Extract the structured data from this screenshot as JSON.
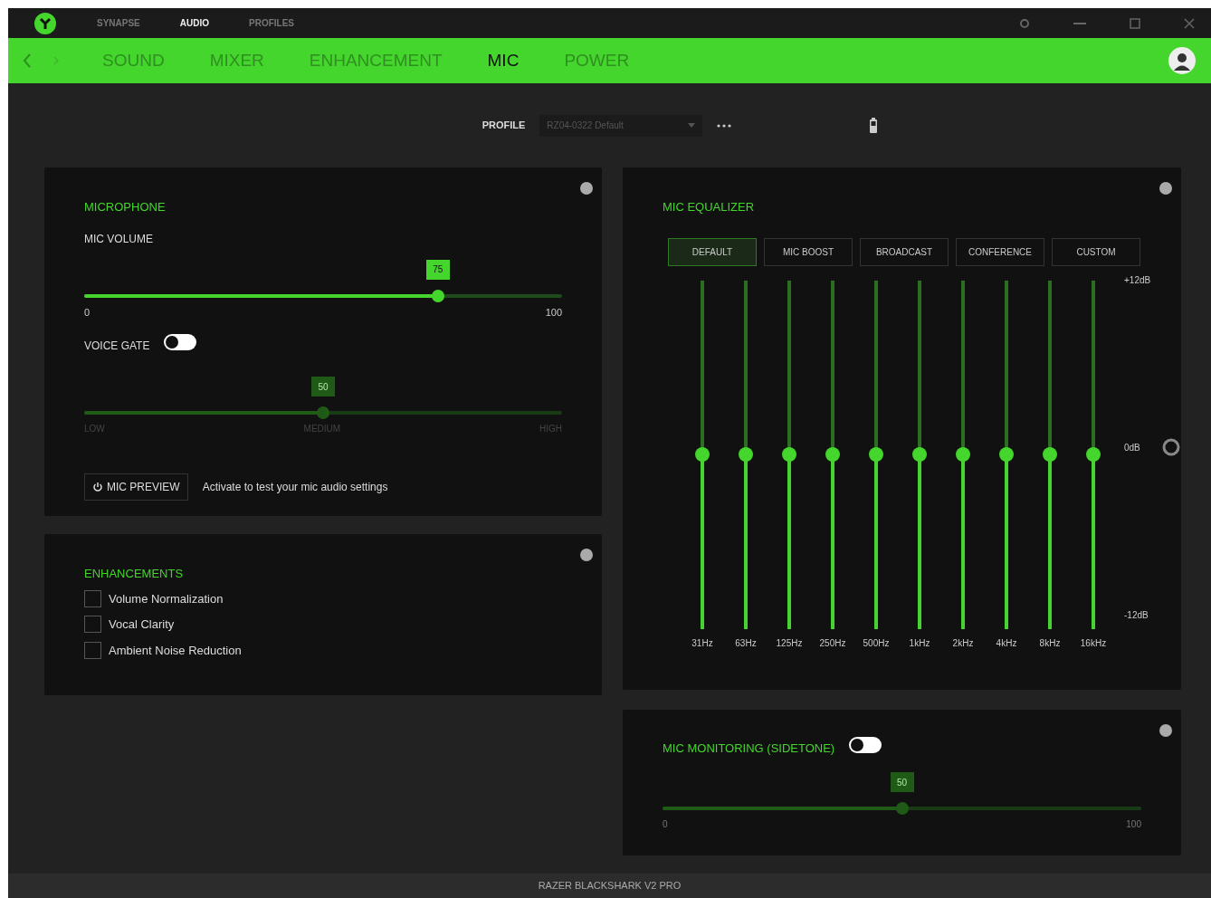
{
  "app_tabs": [
    {
      "label": "SYNAPSE",
      "selected": false
    },
    {
      "label": "AUDIO",
      "selected": true
    },
    {
      "label": "PROFILES",
      "selected": false
    }
  ],
  "section_tabs": [
    {
      "label": "SOUND",
      "selected": false
    },
    {
      "label": "MIXER",
      "selected": false
    },
    {
      "label": "ENHANCEMENT",
      "selected": false
    },
    {
      "label": "MIC",
      "selected": true
    },
    {
      "label": "POWER",
      "selected": false
    }
  ],
  "profile": {
    "label": "PROFILE",
    "value": "RZ04-0322 Default"
  },
  "microphone": {
    "title": "MICROPHONE",
    "volume": {
      "label": "MIC VOLUME",
      "value": "75",
      "level": 0.74,
      "min": "0",
      "max": "100"
    },
    "voice_gate": {
      "label": "VOICE GATE",
      "on": false,
      "value": "50",
      "level": 0.5,
      "ticks": [
        "LOW",
        "MEDIUM",
        "HIGH"
      ]
    },
    "preview": {
      "button": "MIC PREVIEW",
      "hint": "Activate to test your mic audio settings"
    }
  },
  "enhancements": {
    "title": "ENHANCEMENTS",
    "items": [
      {
        "label": "Volume Normalization",
        "checked": false
      },
      {
        "label": "Vocal Clarity",
        "checked": false
      },
      {
        "label": "Ambient Noise Reduction",
        "checked": false
      }
    ]
  },
  "equalizer": {
    "title": "MIC EQUALIZER",
    "presets": [
      {
        "label": "DEFAULT",
        "selected": true
      },
      {
        "label": "MIC BOOST",
        "selected": false
      },
      {
        "label": "BROADCAST",
        "selected": false
      },
      {
        "label": "CONFERENCE",
        "selected": false
      },
      {
        "label": "CUSTOM",
        "selected": false
      }
    ],
    "scale": [
      "+12dB",
      "0dB",
      "-12dB"
    ],
    "bands": [
      {
        "label": "31Hz",
        "level": 0.5
      },
      {
        "label": "63Hz",
        "level": 0.5
      },
      {
        "label": "125Hz",
        "level": 0.5
      },
      {
        "label": "250Hz",
        "level": 0.5
      },
      {
        "label": "500Hz",
        "level": 0.5
      },
      {
        "label": "1kHz",
        "level": 0.5
      },
      {
        "label": "2kHz",
        "level": 0.5
      },
      {
        "label": "4kHz",
        "level": 0.5
      },
      {
        "label": "8kHz",
        "level": 0.5
      },
      {
        "label": "16kHz",
        "level": 0.5
      }
    ]
  },
  "sidetone": {
    "title": "MIC MONITORING (SIDETONE)",
    "on": false,
    "value": "50",
    "level": 0.5,
    "min": "0",
    "max": "100"
  },
  "status_bar": "RAZER BLACKSHARK V2 PRO"
}
